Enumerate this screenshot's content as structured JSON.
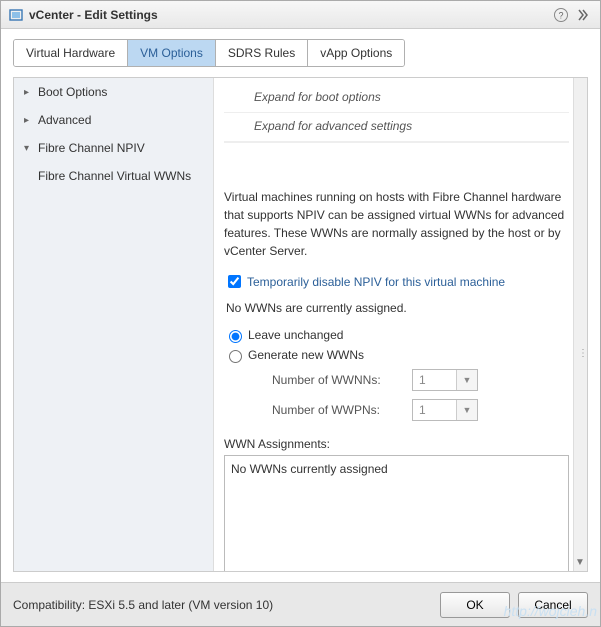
{
  "window": {
    "title": "vCenter - Edit Settings"
  },
  "tabs": {
    "hardware": "Virtual Hardware",
    "vmoptions": "VM Options",
    "sdrs": "SDRS Rules",
    "vapp": "vApp Options"
  },
  "side": {
    "boot": "Boot Options",
    "advanced": "Advanced",
    "fcnpiv": "Fibre Channel NPIV",
    "fcvwwn": "Fibre Channel Virtual WWNs"
  },
  "hints": {
    "boot": "Expand for boot options",
    "advanced": "Expand for advanced settings"
  },
  "npiv": {
    "description": "Virtual machines running on hosts with Fibre Channel hardware that supports NPIV can be assigned virtual WWNs for advanced features. These WWNs are normally assigned by the host or by vCenter Server.",
    "disable_label": "Temporarily disable NPIV for this virtual machine",
    "disable_checked": true,
    "status": "No WWNs are currently assigned.",
    "radio_leave": "Leave unchanged",
    "radio_generate": "Generate new WWNs",
    "selected_radio": "leave",
    "wwnn_label": "Number of WWNNs:",
    "wwnn_value": "1",
    "wwpn_label": "Number of WWPNs:",
    "wwpn_value": "1",
    "assign_label": "WWN Assignments:",
    "assign_text": "No WWNs currently assigned"
  },
  "footer": {
    "compat": "Compatibility: ESXi 5.5 and later (VM version 10)",
    "ok": "OK",
    "cancel": "Cancel"
  },
  "icons": {
    "app": "app-icon",
    "help": "help-icon",
    "expand": "expand-icon"
  },
  "colors": {
    "accent": "#2b5f98",
    "tab_active_bg": "#bcd8f2",
    "side_bg": "#eef1f5"
  },
  "watermark": "http://wojcieh.n"
}
